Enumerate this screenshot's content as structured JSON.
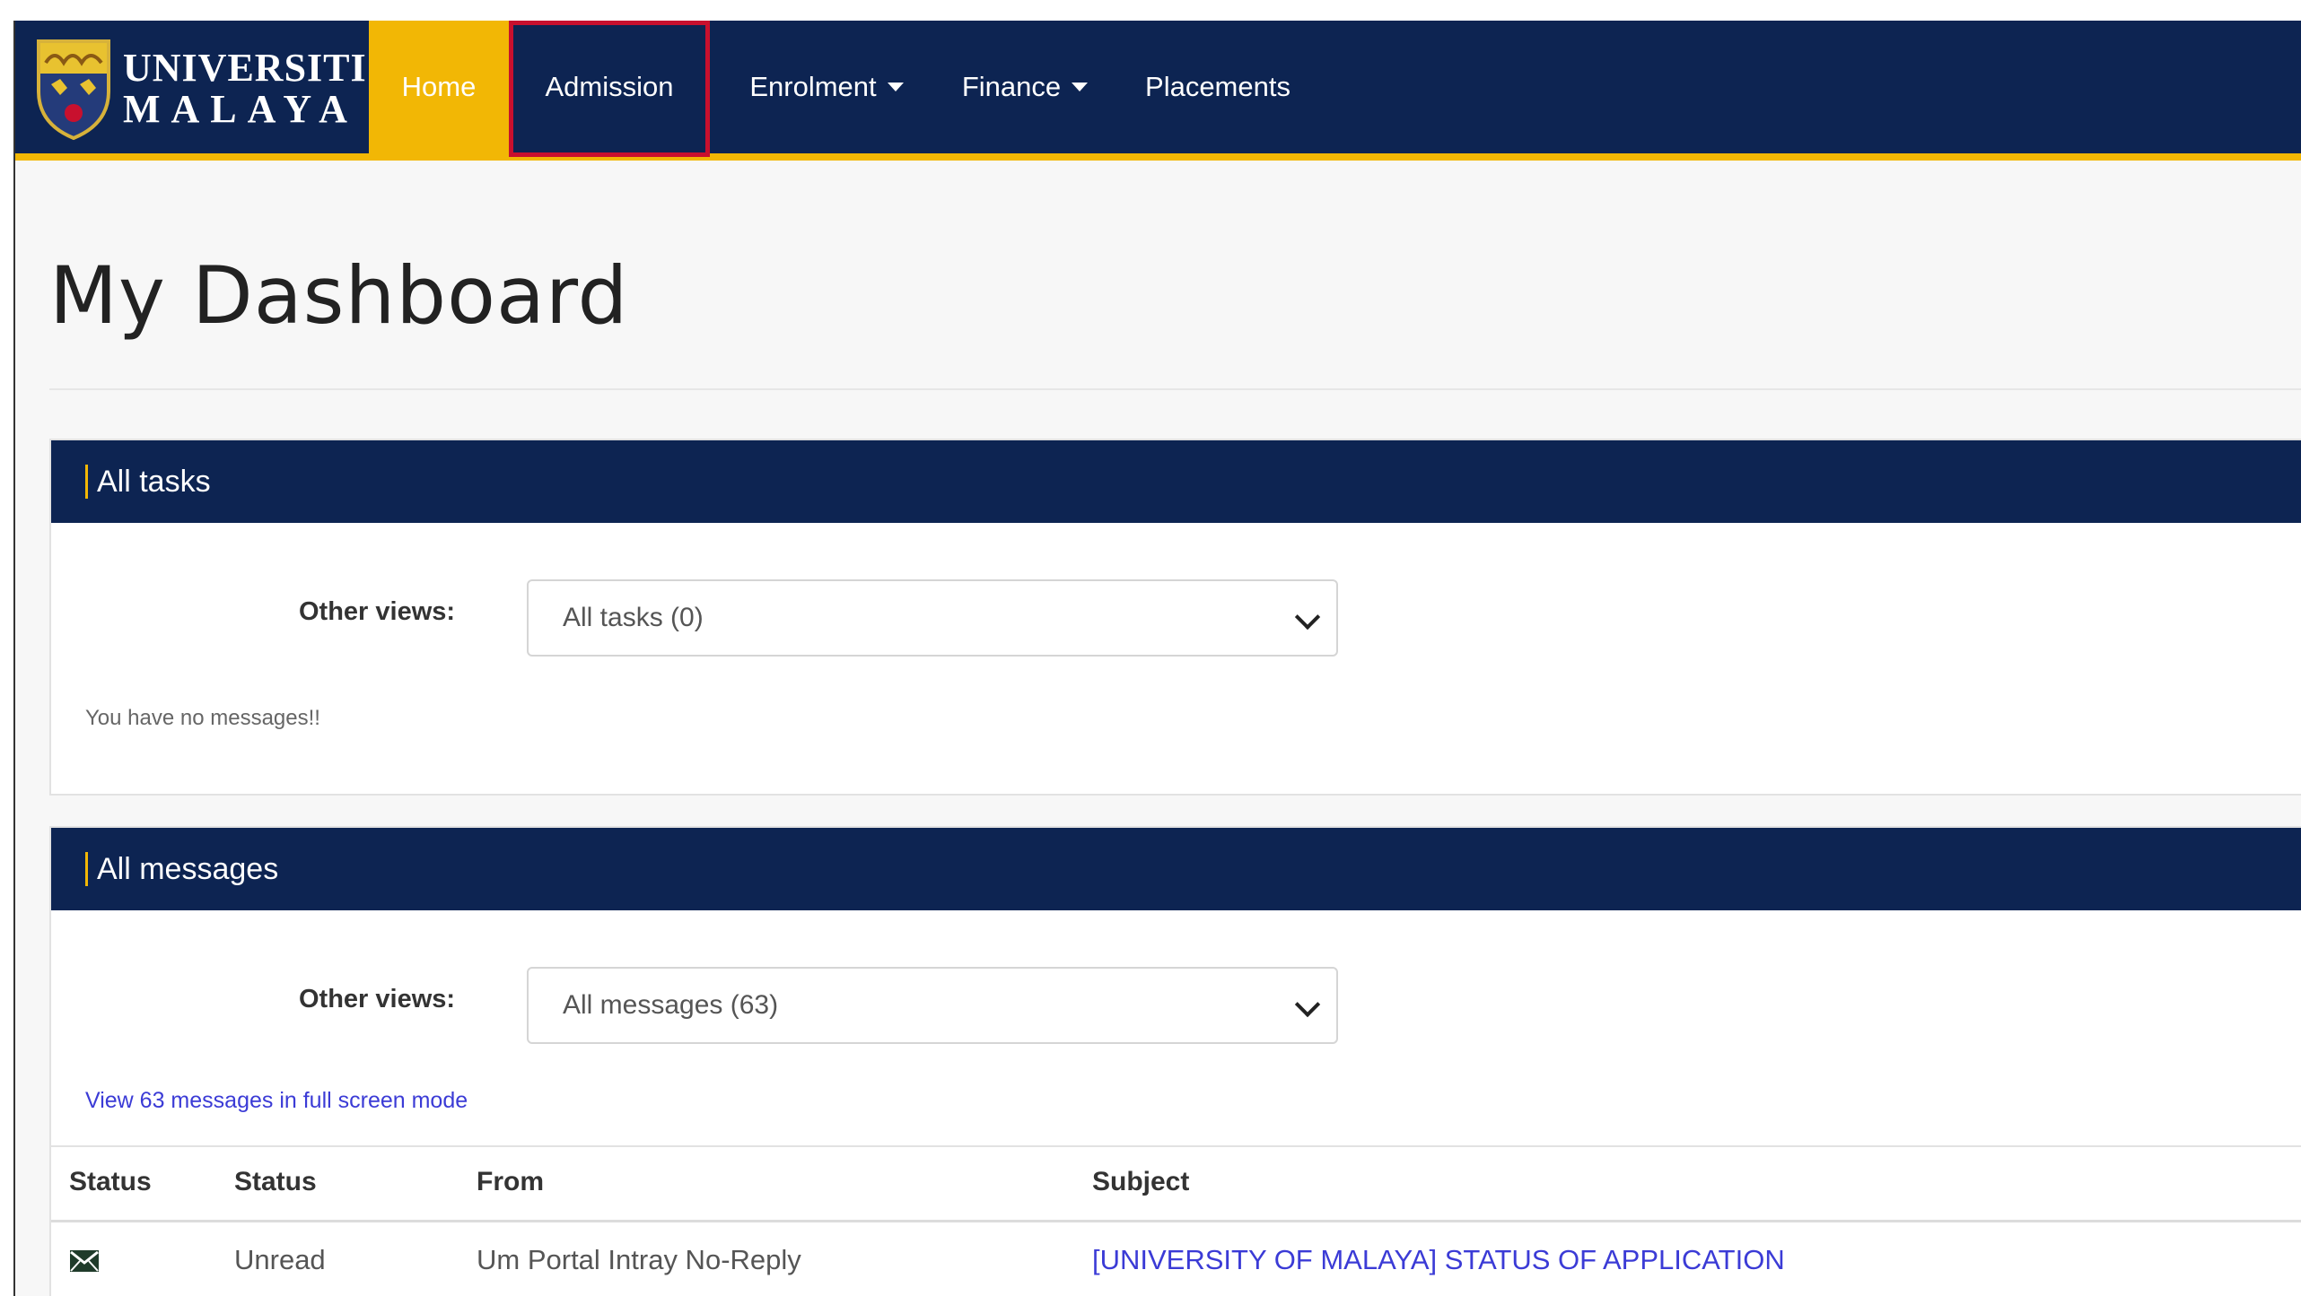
{
  "brand": {
    "line1": "UNIVERSITI",
    "line2": "MALAYA",
    "navy": "#0d2452",
    "gold": "#f2b705"
  },
  "nav": {
    "home": "Home",
    "admission": "Admission",
    "enrolment": "Enrolment",
    "finance": "Finance",
    "placements": "Placements"
  },
  "page": {
    "title": "My Dashboard"
  },
  "tasks": {
    "title": "All tasks",
    "views_label": "Other views:",
    "selected_view": "All tasks (0)",
    "empty_text": "You have no messages!!"
  },
  "messages": {
    "title": "All messages",
    "views_label": "Other views:",
    "selected_view": "All messages (63)",
    "fullscreen_link": "View 63 messages in full screen mode",
    "columns": [
      "Status",
      "Status",
      "From",
      "Subject"
    ],
    "rows": [
      {
        "icon": "envelope-icon",
        "status": "Unread",
        "from": "Um Portal Intray No-Reply",
        "subject": "[UNIVERSITY OF MALAYA] STATUS OF APPLICATION"
      }
    ]
  }
}
